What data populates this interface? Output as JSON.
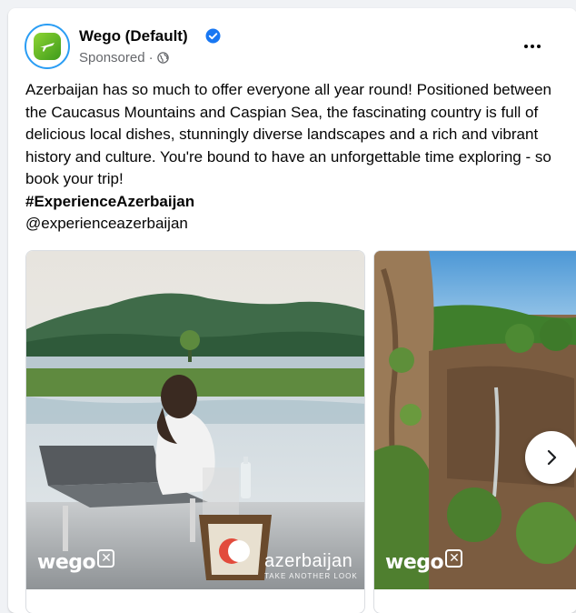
{
  "post": {
    "page_name": "Wego (Default)",
    "sponsored_label": "Sponsored",
    "separator": "·",
    "body_text": "Azerbaijan has so much to offer everyone all year round! Positioned between the Caucasus Mountains and Caspian Sea, the fascinating country is full of delicious local dishes, stunningly diverse landscapes and a rich and vibrant history and culture. You're bound to have an unforgettable time exploring - so book your trip!",
    "hashtag": "#ExperienceAzerbaijan",
    "mention": "@experienceazerbaijan"
  },
  "carousel": {
    "slides": [
      {
        "brand": "wego",
        "partner": "azerbaijan",
        "partner_tagline": "TAKE ANOTHER LOOK"
      },
      {
        "brand": "wego"
      }
    ]
  },
  "icons": {
    "verified": "verified-badge-icon",
    "audience": "globe-icon",
    "more": "more-options-icon",
    "next": "chevron-right-icon"
  },
  "colors": {
    "accent": "#1877f2",
    "avatar_ring": "#2a9df4",
    "wego_green": "#5cb82a"
  }
}
